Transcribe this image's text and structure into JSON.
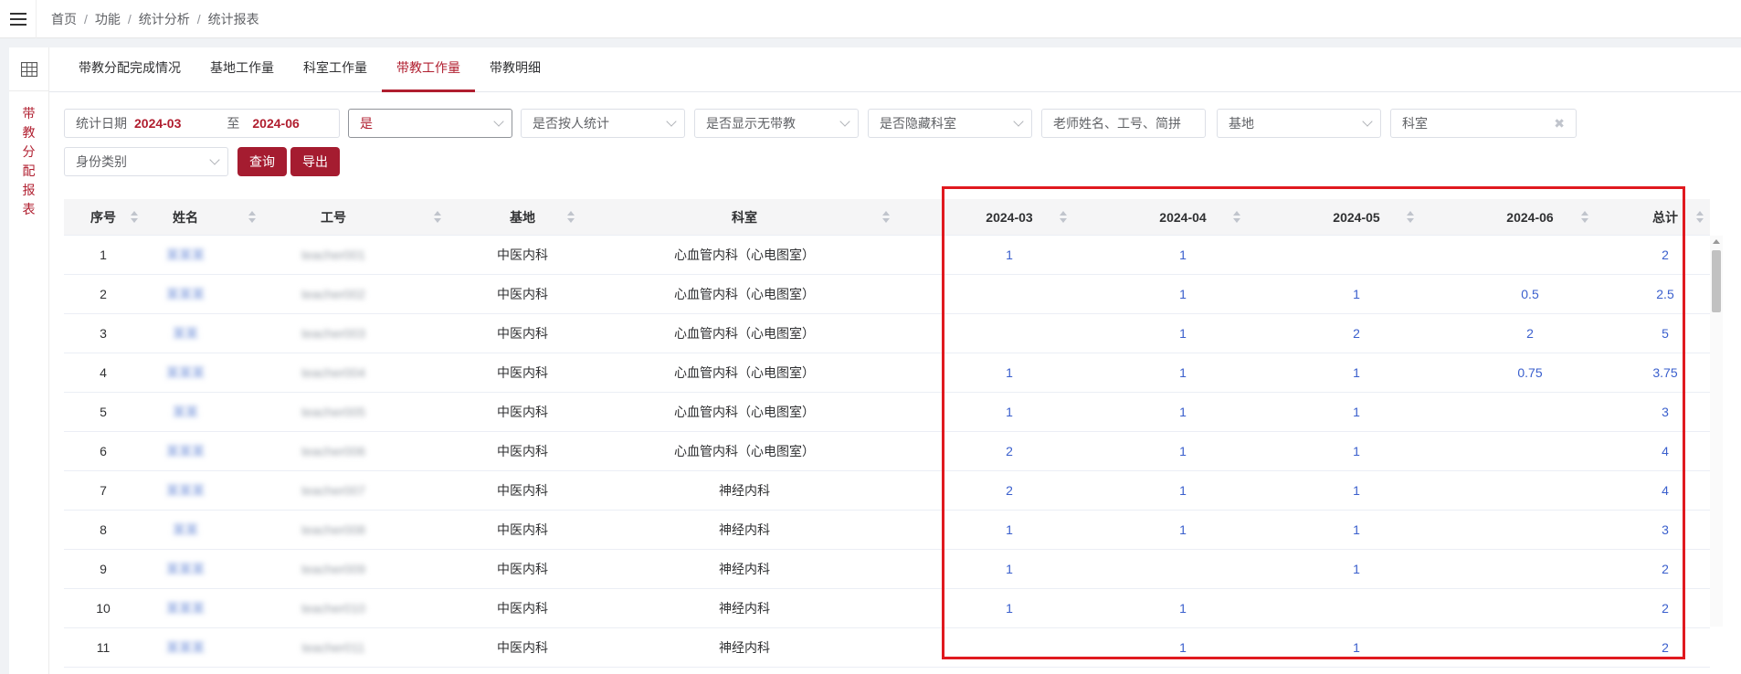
{
  "breadcrumb": [
    "首页",
    "功能",
    "统计分析",
    "统计报表"
  ],
  "sidebar": {
    "vertical_title": [
      "带",
      "教",
      "分",
      "配",
      "报",
      "表"
    ]
  },
  "tabs": [
    {
      "label": "带教分配完成情况",
      "active": false
    },
    {
      "label": "基地工作量",
      "active": false
    },
    {
      "label": "科室工作量",
      "active": false
    },
    {
      "label": "带教工作量",
      "active": true
    },
    {
      "label": "带教明细",
      "active": false
    }
  ],
  "filters": {
    "date_label": "统计日期",
    "date_start": "2024-03",
    "date_sep": "至",
    "date_end": "2024-06",
    "select_yes": "是",
    "by_person": "是否按人统计",
    "show_no_teaching": "是否显示无带教",
    "hide_dept": "是否隐藏科室",
    "teacher_placeholder": "老师姓名、工号、简拼",
    "base": "基地",
    "dept": "科室",
    "identity": "身份类别",
    "query_button": "查询",
    "export_button": "导出"
  },
  "table": {
    "headers": [
      "序号",
      "姓名",
      "工号",
      "基地",
      "科室",
      "2024-03",
      "2024-04",
      "2024-05",
      "2024-06",
      "总计"
    ],
    "rows": [
      {
        "no": "1",
        "name": "某某某",
        "id": "teacher001",
        "base": "中医内科",
        "dept": "心血管内科（心电图室）",
        "m1": "1",
        "m2": "1",
        "m3": "",
        "m4": "",
        "total": "2"
      },
      {
        "no": "2",
        "name": "某某某",
        "id": "teacher002",
        "base": "中医内科",
        "dept": "心血管内科（心电图室）",
        "m1": "",
        "m2": "1",
        "m3": "1",
        "m4": "0.5",
        "total": "2.5"
      },
      {
        "no": "3",
        "name": "某某",
        "id": "teacher003",
        "base": "中医内科",
        "dept": "心血管内科（心电图室）",
        "m1": "",
        "m2": "1",
        "m3": "2",
        "m4": "2",
        "total": "5"
      },
      {
        "no": "4",
        "name": "某某某",
        "id": "teacher004",
        "base": "中医内科",
        "dept": "心血管内科（心电图室）",
        "m1": "1",
        "m2": "1",
        "m3": "1",
        "m4": "0.75",
        "total": "3.75"
      },
      {
        "no": "5",
        "name": "某某",
        "id": "teacher005",
        "base": "中医内科",
        "dept": "心血管内科（心电图室）",
        "m1": "1",
        "m2": "1",
        "m3": "1",
        "m4": "",
        "total": "3"
      },
      {
        "no": "6",
        "name": "某某某",
        "id": "teacher006",
        "base": "中医内科",
        "dept": "心血管内科（心电图室）",
        "m1": "2",
        "m2": "1",
        "m3": "1",
        "m4": "",
        "total": "4"
      },
      {
        "no": "7",
        "name": "某某某",
        "id": "teacher007",
        "base": "中医内科",
        "dept": "神经内科",
        "m1": "2",
        "m2": "1",
        "m3": "1",
        "m4": "",
        "total": "4"
      },
      {
        "no": "8",
        "name": "某某",
        "id": "teacher008",
        "base": "中医内科",
        "dept": "神经内科",
        "m1": "1",
        "m2": "1",
        "m3": "1",
        "m4": "",
        "total": "3"
      },
      {
        "no": "9",
        "name": "某某某",
        "id": "teacher009",
        "base": "中医内科",
        "dept": "神经内科",
        "m1": "1",
        "m2": "",
        "m3": "1",
        "m4": "",
        "total": "2"
      },
      {
        "no": "10",
        "name": "某某某",
        "id": "teacher010",
        "base": "中医内科",
        "dept": "神经内科",
        "m1": "1",
        "m2": "1",
        "m3": "",
        "m4": "",
        "total": "2"
      },
      {
        "no": "11",
        "name": "某某某",
        "id": "teacher011",
        "base": "中医内科",
        "dept": "神经内科",
        "m1": "",
        "m2": "1",
        "m3": "1",
        "m4": "",
        "total": "2"
      }
    ]
  },
  "colors": {
    "accent": "#b01e2f",
    "highlight_box": "#e0191f",
    "link_number": "#3a5fcd"
  }
}
